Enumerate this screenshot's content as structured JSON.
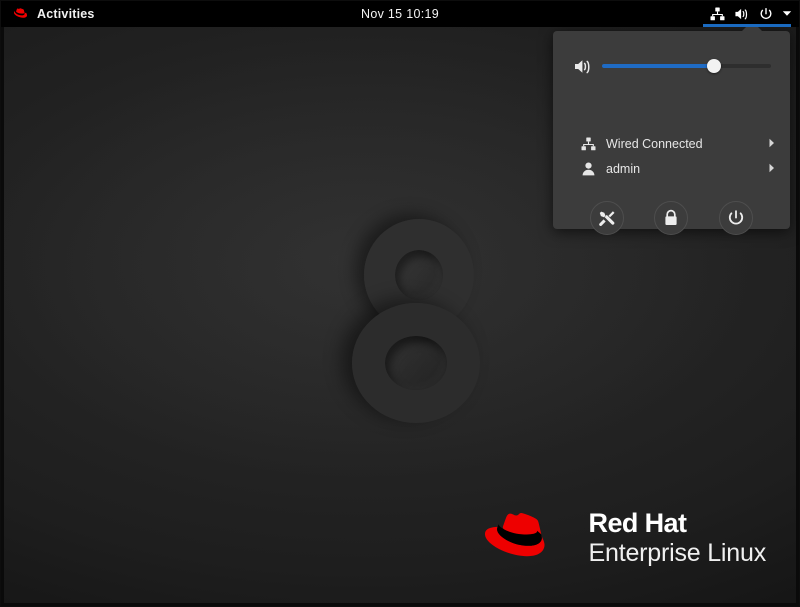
{
  "topbar": {
    "activities_label": "Activities",
    "activities_icon": "redhat-fedora-icon",
    "clock": "Nov 15  10:19",
    "status_icons": [
      "wired-network-icon",
      "volume-icon",
      "power-icon",
      "chevron-down-icon"
    ],
    "accent_color": "#1a6ac0",
    "background_color": "#000000"
  },
  "system_menu": {
    "volume": {
      "icon": "volume-speaker-icon",
      "level_percent": 66,
      "fill_color": "#1f6bc4",
      "track_color": "#2e2e2e"
    },
    "rows": [
      {
        "icon": "wired-network-icon",
        "label": "Wired Connected",
        "arrow": "chevron-right-icon"
      },
      {
        "icon": "user-avatar-icon",
        "label": "admin",
        "arrow": "chevron-right-icon"
      }
    ],
    "actions": [
      {
        "icon": "settings-tools-icon",
        "name": "settings"
      },
      {
        "icon": "lock-padlock-icon",
        "name": "lock-screen"
      },
      {
        "icon": "power-icon",
        "name": "power-off"
      }
    ],
    "background_color": "#3c3c3c"
  },
  "desktop": {
    "wallpaper_numeral": "8",
    "wallpaper_base_color": "#1e1e1e",
    "logo": {
      "icon": "red-hat-fedora-logo",
      "brand_color": "#ee0000",
      "line1": "Red Hat",
      "line2": "Enterprise Linux"
    }
  }
}
